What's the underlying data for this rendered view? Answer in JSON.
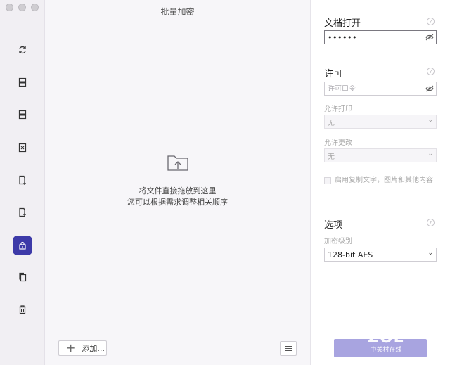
{
  "window": {
    "title": "批量加密"
  },
  "rail": {
    "items": [
      {
        "name": "convert",
        "icon": "refresh-icon"
      },
      {
        "name": "ocr",
        "icon": "ocr-document-icon"
      },
      {
        "name": "pdf-to-word",
        "icon": "file-convert-icon"
      },
      {
        "name": "compress",
        "icon": "file-compress-icon"
      },
      {
        "name": "create",
        "icon": "file-add-icon"
      },
      {
        "name": "merge",
        "icon": "file-merge-icon"
      },
      {
        "name": "encrypt",
        "icon": "lock-icon",
        "active": true
      },
      {
        "name": "copy",
        "icon": "copy-icon"
      },
      {
        "name": "delete",
        "icon": "trash-icon"
      }
    ]
  },
  "drop_area": {
    "line1": "将文件直接拖放到这里",
    "line2": "您可以根据需求调整相关顺序",
    "add_label": "添加..."
  },
  "settings": {
    "open_section": {
      "title": "文档打开",
      "password_value": "••••••"
    },
    "permission_section": {
      "title": "许可",
      "password_placeholder": "许可口令",
      "allow_print_label": "允许打印",
      "allow_print_value": "无",
      "allow_change_label": "允许更改",
      "allow_change_value": "无",
      "enable_copy_label": "启用复制文字，图片和其他内容"
    },
    "options_section": {
      "title": "选项",
      "encryption_level_label": "加密级别",
      "encryption_level_value": "128-bit AES"
    }
  },
  "watermark": {
    "brand": "ZOL",
    "sub": "中关村在线"
  },
  "colors": {
    "accent": "#3d3aa8",
    "submit": "#a8a4e0",
    "rail_bg": "#f1eff3",
    "center_bg": "#f7f6f9"
  }
}
